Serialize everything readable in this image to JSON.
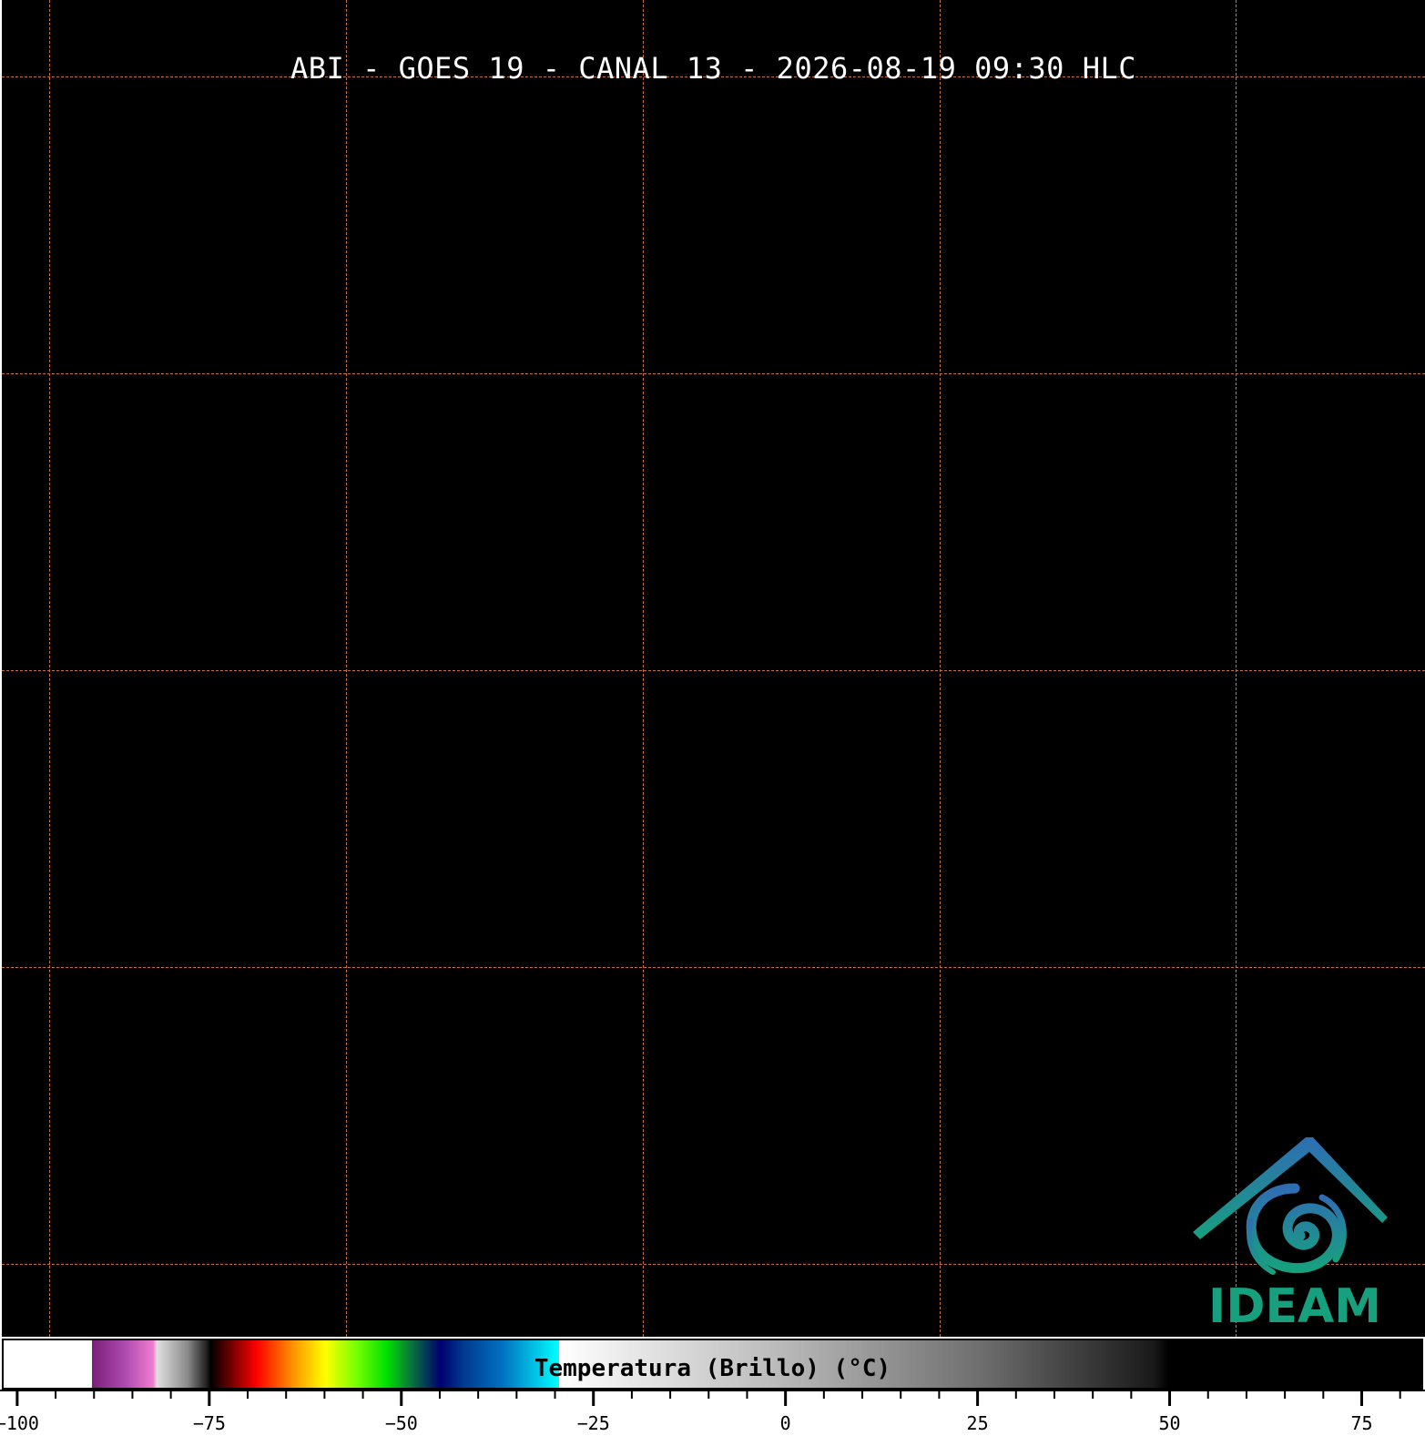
{
  "title": "ABI - GOES 19 - CANAL 13 - 2026-08-19 09:30 HLC",
  "logo": {
    "text": "IDEAM",
    "icon": "ideam-swirl-roof-icon",
    "color_top": "#2f6db3",
    "color_bottom": "#17a07e"
  },
  "grid": {
    "color": "#c8703c",
    "style": "dashed"
  },
  "colorbar": {
    "label": "Temperatura (Brillo) (°C)",
    "range": [
      -102,
      83
    ],
    "major_ticks": [
      -100,
      -75,
      -50,
      -25,
      0,
      25,
      50,
      75
    ],
    "minor_step": 5,
    "stops": [
      {
        "t": -102,
        "c": "#ffffff"
      },
      {
        "t": -90.5,
        "c": "#ffffff"
      },
      {
        "t": -90.5,
        "c": "#7a1f7a"
      },
      {
        "t": -86,
        "c": "#b04cb0"
      },
      {
        "t": -82.5,
        "c": "#f07ccf"
      },
      {
        "t": -82,
        "c": "#e0e0e0"
      },
      {
        "t": -78,
        "c": "#8a8a8a"
      },
      {
        "t": -75.5,
        "c": "#202020"
      },
      {
        "t": -75,
        "c": "#000000"
      },
      {
        "t": -69,
        "c": "#ff0000"
      },
      {
        "t": -64,
        "c": "#ff9a00"
      },
      {
        "t": -60,
        "c": "#ffff00"
      },
      {
        "t": -56,
        "c": "#77ff00"
      },
      {
        "t": -52,
        "c": "#00e000"
      },
      {
        "t": -49,
        "c": "#0a7a3a"
      },
      {
        "t": -45,
        "c": "#000070"
      },
      {
        "t": -42,
        "c": "#003a90"
      },
      {
        "t": -37,
        "c": "#0070c0"
      },
      {
        "t": -29.5,
        "c": "#00ffff"
      },
      {
        "t": -29.5,
        "c": "#ffffff"
      },
      {
        "t": -25,
        "c": "#f4f4f4"
      },
      {
        "t": 0,
        "c": "#b8b8b8"
      },
      {
        "t": 25,
        "c": "#707070"
      },
      {
        "t": 48,
        "c": "#1a1a1a"
      },
      {
        "t": 50,
        "c": "#000000"
      },
      {
        "t": 83,
        "c": "#000000"
      }
    ]
  }
}
